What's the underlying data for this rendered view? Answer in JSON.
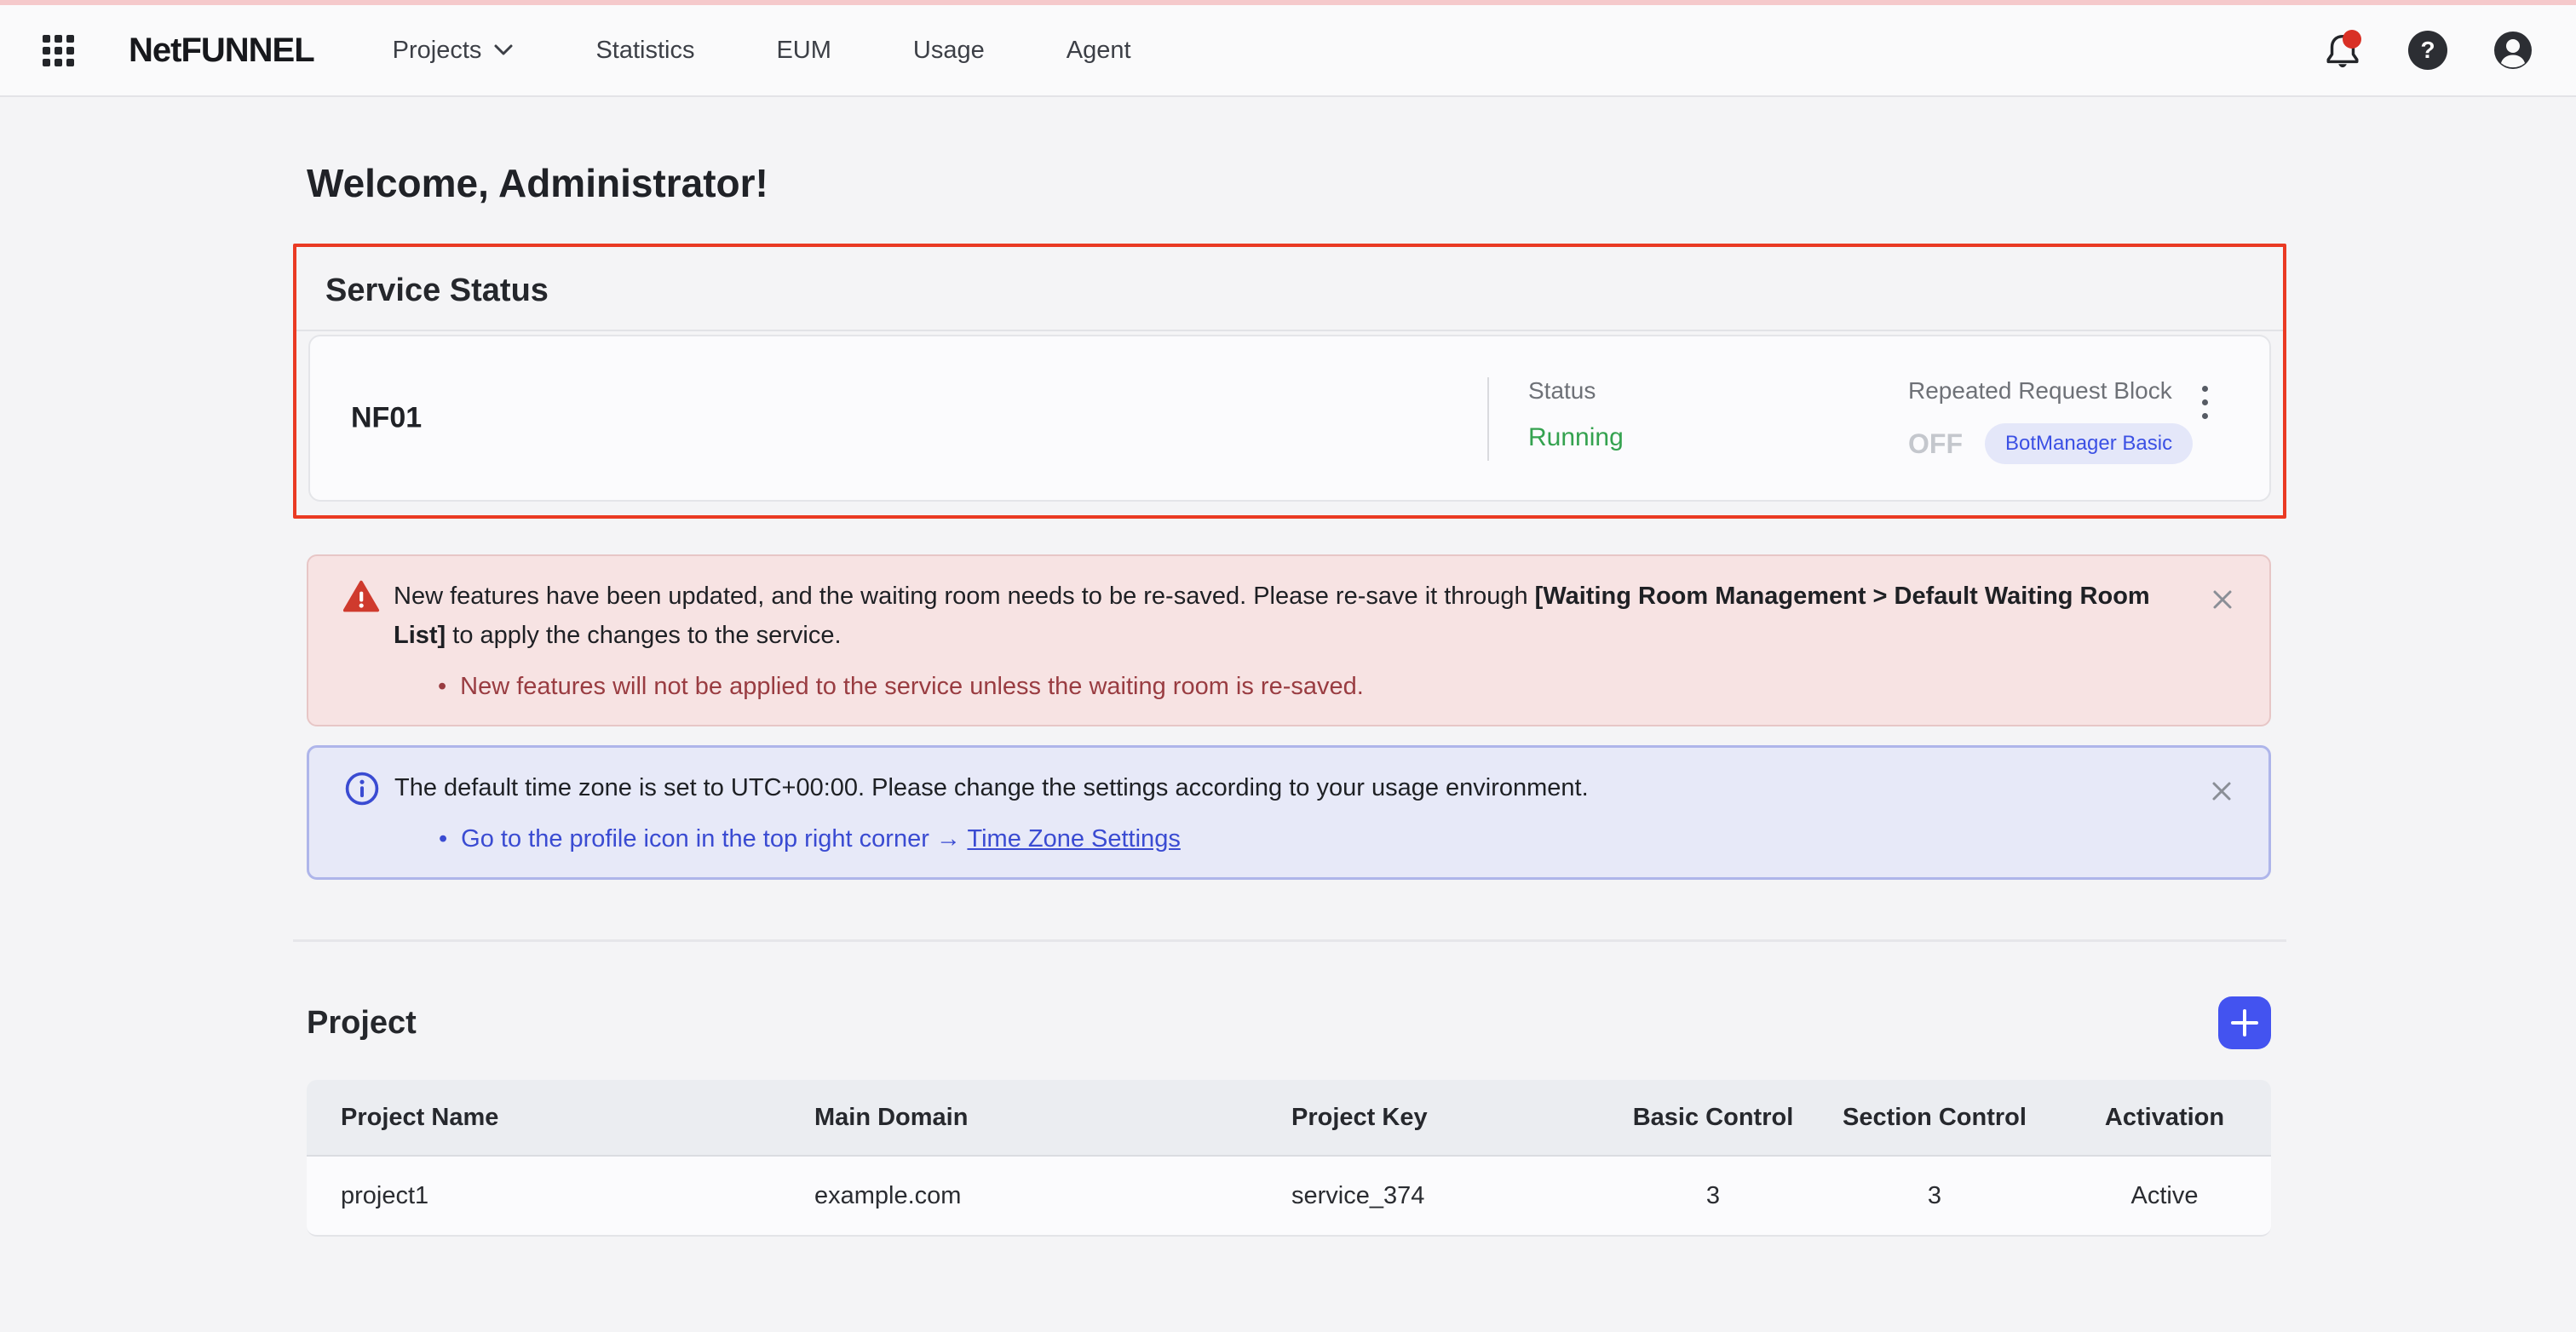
{
  "ui": {
    "bullet": "•"
  },
  "colors": {
    "accent_blue": "#4353f0",
    "badge_blue": "#3b50e4",
    "success_green": "#34a24f",
    "highlight_border_red": "#ea3a23",
    "warning_bg": "#f7e3e3",
    "info_bg": "#e7e9f8",
    "top_strip_pink": "#f5c9cb"
  },
  "topbar": {
    "logo": "NetFUNNEL",
    "nav": {
      "projects": "Projects",
      "statistics": "Statistics",
      "eum": "EUM",
      "usage": "Usage",
      "agent": "Agent"
    },
    "help_glyph": "?"
  },
  "page": {
    "welcome": "Welcome, Administrator!"
  },
  "service_status": {
    "title": "Service Status",
    "server_name": "NF01",
    "status_label": "Status",
    "status_value": "Running",
    "rrb_label": "Repeated Request Block",
    "rrb_value": "OFF",
    "rrb_badge": "BotManager Basic"
  },
  "alerts": {
    "warning": {
      "msg_pre": "New features have been updated, and the waiting room needs to be re-saved. Please re-save it through ",
      "msg_bold": "[Waiting Room Management > Default Waiting Room List]",
      "msg_post": " to apply the changes to the service.",
      "bullet_text": "New features will not be applied to the service unless the waiting room is re-saved."
    },
    "info": {
      "message": "The default time zone is set to UTC+00:00. Please change the settings according to your usage environment.",
      "bullet_pre": "Go to the profile icon in the top right corner → ",
      "link_text": "Time Zone Settings"
    }
  },
  "project": {
    "title": "Project",
    "table": {
      "columns": [
        "Project Name",
        "Main Domain",
        "Project Key",
        "Basic Control",
        "Section Control",
        "Activation"
      ],
      "rows": [
        {
          "name": "project1",
          "domain": "example.com",
          "key": "service_374",
          "basic": "3",
          "section": "3",
          "activation": "Active"
        }
      ]
    }
  }
}
